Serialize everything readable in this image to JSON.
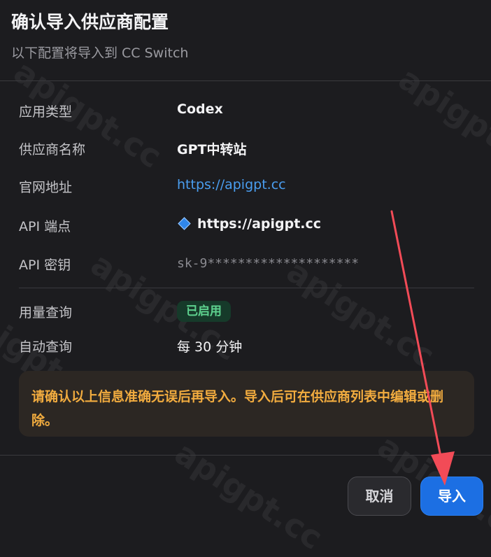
{
  "dialog": {
    "title": "确认导入供应商配置",
    "subtitle": "以下配置将导入到 CC Switch"
  },
  "fields": {
    "app_type": {
      "label": "应用类型",
      "value": "Codex"
    },
    "provider_name": {
      "label": "供应商名称",
      "value": "GPT中转站"
    },
    "website": {
      "label": "官网地址",
      "value": "https://apigpt.cc"
    },
    "api_endpoint": {
      "label": "API 端点",
      "value": "https://apigpt.cc",
      "icon": "diamond-icon"
    },
    "api_key": {
      "label": "API 密钥",
      "value": "sk-9********************"
    },
    "usage_query": {
      "label": "用量查询",
      "value": "已启用"
    },
    "auto_query": {
      "label": "自动查询",
      "value": "每 30 分钟"
    }
  },
  "notice": {
    "text": "请确认以上信息准确无误后再导入。导入后可在供应商列表中编辑或删除。"
  },
  "buttons": {
    "cancel": "取消",
    "import": "导入"
  },
  "watermark": "apigpt.cc",
  "colors": {
    "background": "#1c1c1f",
    "link": "#4a9ef0",
    "badge_bg": "#163a2a",
    "badge_text": "#5ed28f",
    "notice_text": "#f2ac3f",
    "primary": "#1c6fe3",
    "annotation_arrow": "#f24b57"
  }
}
